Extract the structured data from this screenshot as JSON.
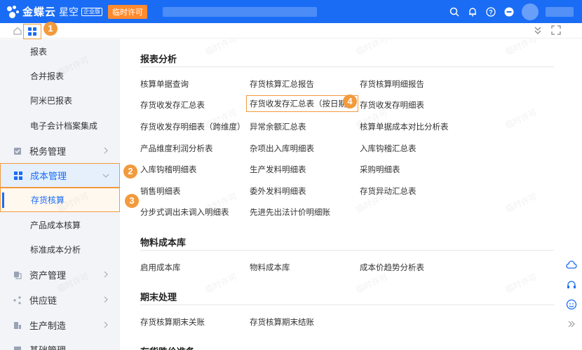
{
  "topbar": {
    "brand": "金蝶云",
    "sub": "星空",
    "edition": "企业版",
    "license": "临时许可"
  },
  "markers": [
    "1",
    "2",
    "3",
    "4"
  ],
  "sidebar": {
    "items": [
      {
        "label": "报表",
        "kind": "sub"
      },
      {
        "label": "合并报表",
        "kind": "sub"
      },
      {
        "label": "阿米巴报表",
        "kind": "sub"
      },
      {
        "label": "电子会计档案集成",
        "kind": "sub"
      },
      {
        "label": "税务管理",
        "kind": "group",
        "icon": "tax-icon"
      },
      {
        "label": "成本管理",
        "kind": "group-active",
        "icon": "cost-icon"
      },
      {
        "label": "存货核算",
        "kind": "sub-active"
      },
      {
        "label": "产品成本核算",
        "kind": "sub"
      },
      {
        "label": "标准成本分析",
        "kind": "sub"
      },
      {
        "label": "资产管理",
        "kind": "group",
        "icon": "asset-icon"
      },
      {
        "label": "供应链",
        "kind": "group",
        "icon": "supply-chain-icon"
      },
      {
        "label": "生产制造",
        "kind": "group",
        "icon": "manufacturing-icon"
      },
      {
        "label": "基础管理",
        "kind": "group",
        "icon": "basic-icon"
      }
    ]
  },
  "sections": [
    {
      "title": "报表分析",
      "rows": [
        [
          "核算单据查询",
          "存货核算汇总报告",
          "存货核算明细报告"
        ],
        [
          "存货收发存汇总表",
          "存货收发存汇总表（按日期）",
          "存货收发存明细表"
        ],
        [
          "存货收发存明细表（跨维度）",
          "异常余额汇总表",
          "核算单据成本对比分析表"
        ],
        [
          "产品维度利润分析表",
          "杂项出入库明细表",
          "入库钩稽汇总表"
        ],
        [
          "入库钩稽明细表",
          "生产发料明细表",
          "采购明细表"
        ],
        [
          "销售明细表",
          "委外发料明细表",
          "存货异动汇总表"
        ],
        [
          "分步式调出未调入明细表",
          "先进先出法计价明细账",
          ""
        ]
      ]
    },
    {
      "title": "物料成本库",
      "rows": [
        [
          "启用成本库",
          "物料成本库",
          "成本价趋势分析表"
        ]
      ]
    },
    {
      "title": "期末处理",
      "rows": [
        [
          "存货核算期末关账",
          "存货核算期末结账",
          ""
        ]
      ]
    },
    {
      "title": "存货跌价准备",
      "rows": []
    }
  ],
  "watermark": "临时许可",
  "colors": {
    "primary": "#1a6cf5",
    "marker": "#f39a3c",
    "license_badge": "#ff8b2e"
  }
}
